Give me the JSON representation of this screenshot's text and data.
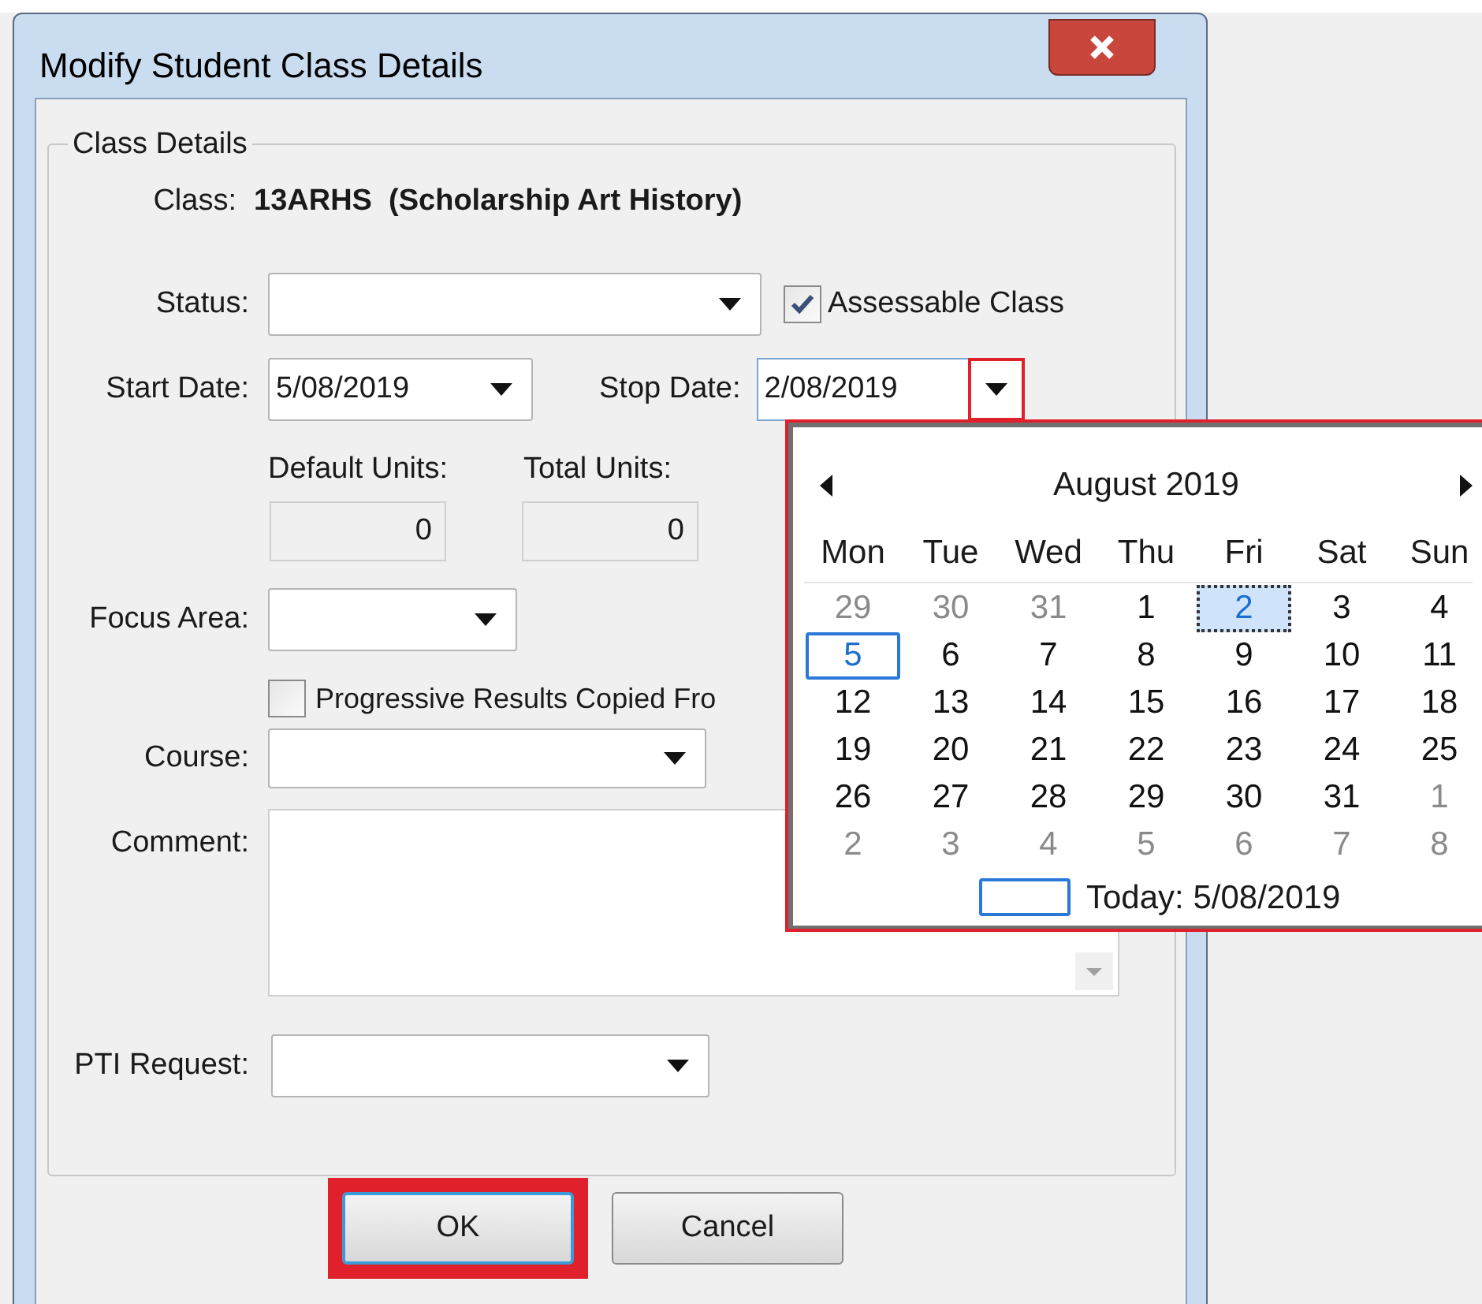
{
  "window": {
    "title": "Modify Student Class Details"
  },
  "group": {
    "title": "Class Details"
  },
  "class_info": {
    "label": "Class:",
    "value": "13ARHS  (Scholarship Art History)"
  },
  "status": {
    "label": "Status:"
  },
  "assessable": {
    "label": "Assessable Class",
    "checked": true
  },
  "start_date": {
    "label": "Start Date:",
    "value": "5/08/2019"
  },
  "stop_date": {
    "label": "Stop Date:",
    "value": "2/08/2019",
    "annotated": true
  },
  "default_units": {
    "label": "Default Units:",
    "value": "0"
  },
  "total_units": {
    "label": "Total Units:",
    "value": "0"
  },
  "focus_area": {
    "label": "Focus Area:"
  },
  "progressive": {
    "label": "Progressive Results Copied Fro",
    "checked": false
  },
  "course": {
    "label": "Course:"
  },
  "comment": {
    "label": "Comment:"
  },
  "pti_request": {
    "label": "PTI Request:"
  },
  "calendar": {
    "title": "August 2019",
    "annotated": true,
    "weekdays": [
      "Mon",
      "Tue",
      "Wed",
      "Thu",
      "Fri",
      "Sat",
      "Sun"
    ],
    "weeks": [
      [
        {
          "day": "29",
          "other_month": true,
          "selected": false,
          "today": false
        },
        {
          "day": "30",
          "other_month": true,
          "selected": false,
          "today": false
        },
        {
          "day": "31",
          "other_month": true,
          "selected": false,
          "today": false
        },
        {
          "day": "1",
          "other_month": false,
          "selected": false,
          "today": false
        },
        {
          "day": "2",
          "other_month": false,
          "selected": true,
          "today": false
        },
        {
          "day": "3",
          "other_month": false,
          "selected": false,
          "today": false
        },
        {
          "day": "4",
          "other_month": false,
          "selected": false,
          "today": false
        }
      ],
      [
        {
          "day": "5",
          "other_month": false,
          "selected": false,
          "today": true
        },
        {
          "day": "6",
          "other_month": false,
          "selected": false,
          "today": false
        },
        {
          "day": "7",
          "other_month": false,
          "selected": false,
          "today": false
        },
        {
          "day": "8",
          "other_month": false,
          "selected": false,
          "today": false
        },
        {
          "day": "9",
          "other_month": false,
          "selected": false,
          "today": false
        },
        {
          "day": "10",
          "other_month": false,
          "selected": false,
          "today": false
        },
        {
          "day": "11",
          "other_month": false,
          "selected": false,
          "today": false
        }
      ],
      [
        {
          "day": "12",
          "other_month": false,
          "selected": false,
          "today": false
        },
        {
          "day": "13",
          "other_month": false,
          "selected": false,
          "today": false
        },
        {
          "day": "14",
          "other_month": false,
          "selected": false,
          "today": false
        },
        {
          "day": "15",
          "other_month": false,
          "selected": false,
          "today": false
        },
        {
          "day": "16",
          "other_month": false,
          "selected": false,
          "today": false
        },
        {
          "day": "17",
          "other_month": false,
          "selected": false,
          "today": false
        },
        {
          "day": "18",
          "other_month": false,
          "selected": false,
          "today": false
        }
      ],
      [
        {
          "day": "19",
          "other_month": false,
          "selected": false,
          "today": false
        },
        {
          "day": "20",
          "other_month": false,
          "selected": false,
          "today": false
        },
        {
          "day": "21",
          "other_month": false,
          "selected": false,
          "today": false
        },
        {
          "day": "22",
          "other_month": false,
          "selected": false,
          "today": false
        },
        {
          "day": "23",
          "other_month": false,
          "selected": false,
          "today": false
        },
        {
          "day": "24",
          "other_month": false,
          "selected": false,
          "today": false
        },
        {
          "day": "25",
          "other_month": false,
          "selected": false,
          "today": false
        }
      ],
      [
        {
          "day": "26",
          "other_month": false,
          "selected": false,
          "today": false
        },
        {
          "day": "27",
          "other_month": false,
          "selected": false,
          "today": false
        },
        {
          "day": "28",
          "other_month": false,
          "selected": false,
          "today": false
        },
        {
          "day": "29",
          "other_month": false,
          "selected": false,
          "today": false
        },
        {
          "day": "30",
          "other_month": false,
          "selected": false,
          "today": false
        },
        {
          "day": "31",
          "other_month": false,
          "selected": false,
          "today": false
        },
        {
          "day": "1",
          "other_month": true,
          "selected": false,
          "today": false
        }
      ],
      [
        {
          "day": "2",
          "other_month": true,
          "selected": false,
          "today": false
        },
        {
          "day": "3",
          "other_month": true,
          "selected": false,
          "today": false
        },
        {
          "day": "4",
          "other_month": true,
          "selected": false,
          "today": false
        },
        {
          "day": "5",
          "other_month": true,
          "selected": false,
          "today": false
        },
        {
          "day": "6",
          "other_month": true,
          "selected": false,
          "today": false
        },
        {
          "day": "7",
          "other_month": true,
          "selected": false,
          "today": false
        },
        {
          "day": "8",
          "other_month": true,
          "selected": false,
          "today": false
        }
      ]
    ],
    "today_label": "Today: 5/08/2019"
  },
  "buttons": [
    {
      "label": "OK",
      "focused": true,
      "annotated": true
    },
    {
      "label": "Cancel",
      "focused": false,
      "annotated": false
    }
  ]
}
